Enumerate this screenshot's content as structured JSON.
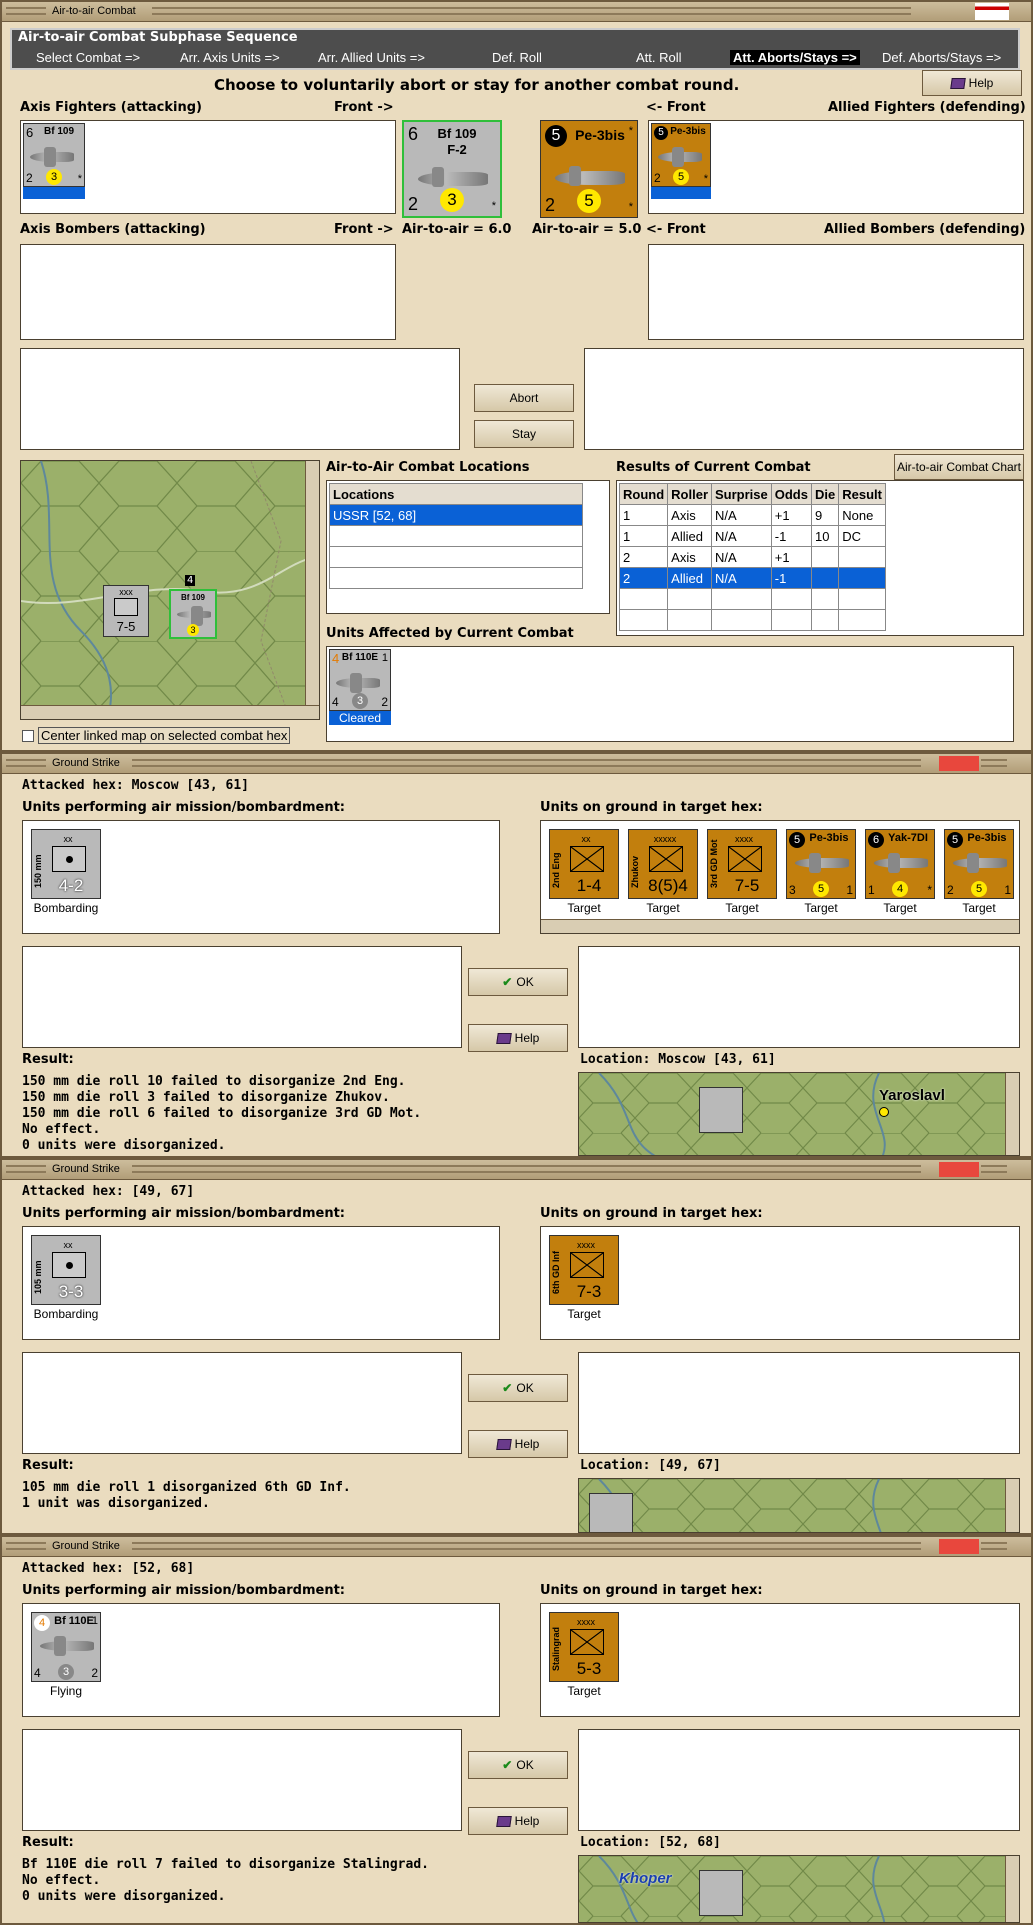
{
  "air": {
    "window_title": "Air-to-air Combat",
    "sequence_title": "Air-to-air Combat Subphase Sequence",
    "steps": [
      "Select Combat =>",
      "Arr. Axis Units =>",
      "Arr. Allied Units =>",
      "Def. Roll",
      "Att. Roll",
      "Att. Aborts/Stays =>",
      "Def. Aborts/Stays =>"
    ],
    "instruction": "Choose to voluntarily abort or stay for another combat round.",
    "help": "Help",
    "axis_fighters": "Axis Fighters (attacking)",
    "front_right": "Front ->",
    "front_left": "<- Front",
    "allied_fighters": "Allied Fighters (defending)",
    "axis_bombers": "Axis Bombers (attacking)",
    "allied_bombers": "Allied Bombers (defending)",
    "axis_ata": "Air-to-air = 6.0",
    "allied_ata": "Air-to-air = 5.0",
    "abort": "Abort",
    "stay": "Stay",
    "locations_title": "Air-to-Air Combat Locations",
    "locations_header": "Locations",
    "locations": [
      "USSR [52, 68]"
    ],
    "results_title": "Results of Current Combat",
    "chart_btn": "Air-to-air Combat Chart",
    "results_headers": [
      "Round",
      "Roller",
      "Surprise",
      "Odds",
      "Die",
      "Result"
    ],
    "results_rows": [
      [
        "1",
        "Axis",
        "N/A",
        "+1",
        "9",
        "None"
      ],
      [
        "1",
        "Allied",
        "N/A",
        "-1",
        "10",
        "DC"
      ],
      [
        "2",
        "Axis",
        "N/A",
        "+1",
        "",
        ""
      ],
      [
        "2",
        "Allied",
        "N/A",
        "-1",
        "",
        ""
      ]
    ],
    "affected_title": "Units Affected by Current Combat",
    "affected_status": "Cleared",
    "center_label": "Center linked map on selected combat hex",
    "axis_fighter": {
      "name": "Bf 109",
      "sub": "F-2",
      "tl": "6",
      "bl": "2",
      "mid": "3",
      "tr": "*"
    },
    "allied_fighter": {
      "name": "Pe-3bis",
      "tl": "5",
      "bl": "2",
      "mid": "5",
      "tr": "*"
    },
    "affected_unit": {
      "name": "Bf 110E",
      "tl": "4",
      "tr": "1",
      "bl": "4",
      "mid": "3",
      "br": "2"
    },
    "map_units": {
      "inf": "7-5",
      "inf_top": "xxx",
      "ftr": "Bf 109",
      "stack": "4"
    }
  },
  "strikes": [
    {
      "window_title": "Ground Strike",
      "attacked_hex": "Attacked hex: Moscow  [43, 61]",
      "performing_label": "Units performing air mission/bombardment:",
      "ground_label": "Units on ground in target hex:",
      "attacker": {
        "type": "art",
        "size": "150 mm",
        "top": "xx",
        "str": "4-2",
        "cap": "Bombarding"
      },
      "targets": [
        {
          "type": "unit",
          "side": "2nd Eng",
          "top": "xx",
          "str": "1-4",
          "cap": "Target"
        },
        {
          "type": "unit",
          "side": "Zhukov",
          "top": "xxxxx",
          "str": "8(5)4",
          "cap": "Target"
        },
        {
          "type": "unit",
          "side": "3rd GD Mot",
          "top": "xxxx",
          "str": "7-5",
          "cap": "Target"
        },
        {
          "type": "plane",
          "name": "Pe-3bis",
          "tl": "5",
          "bl": "3",
          "mid": "5",
          "br": "1",
          "cap": "Target"
        },
        {
          "type": "plane",
          "name": "Yak-7DI",
          "tl": "6",
          "bl": "1",
          "mid": "4",
          "br": "*",
          "cap": "Target"
        },
        {
          "type": "plane",
          "name": "Pe-3bis",
          "tl": "5",
          "bl": "2",
          "mid": "5",
          "br": "1",
          "cap": "Target"
        }
      ],
      "ok": "OK",
      "help": "Help",
      "result_label": "Result:",
      "result_lines": [
        "150 mm die roll 10 failed to disorganize 2nd Eng.",
        "150 mm die roll 3 failed to disorganize Zhukov.",
        "150 mm die roll 6 failed to disorganize 3rd GD Mot.",
        "No effect.",
        "0 units were disorganized."
      ],
      "location_label": "Location:  Moscow  [43, 61]",
      "map_label": "Yaroslavl"
    },
    {
      "window_title": "Ground Strike",
      "attacked_hex": "Attacked hex:  [49, 67]",
      "performing_label": "Units performing air mission/bombardment:",
      "ground_label": "Units on ground in target hex:",
      "attacker": {
        "type": "art",
        "size": "105 mm",
        "top": "xx",
        "str": "3-3",
        "cap": "Bombarding"
      },
      "targets": [
        {
          "type": "unit",
          "side": "6th GD Inf",
          "top": "xxxx",
          "str": "7-3",
          "cap": "Target"
        }
      ],
      "ok": "OK",
      "help": "Help",
      "result_label": "Result:",
      "result_lines": [
        "105 mm die roll 1 disorganized 6th GD Inf.",
        "1 unit was disorganized."
      ],
      "location_label": "Location:  [49, 67]",
      "map_label": ""
    },
    {
      "window_title": "Ground Strike",
      "attacked_hex": "Attacked hex:  [52, 68]",
      "performing_label": "Units performing air mission/bombardment:",
      "ground_label": "Units on ground in target hex:",
      "attacker": {
        "type": "plane",
        "name": "Bf 110E",
        "tl": "4",
        "tr": "1",
        "bl": "4",
        "mid": "3",
        "br": "2",
        "cap": "Flying"
      },
      "targets": [
        {
          "type": "unit",
          "side": "Stalingrad",
          "top": "xxxx",
          "str": "5-3",
          "cap": "Target"
        }
      ],
      "ok": "OK",
      "help": "Help",
      "result_label": "Result:",
      "result_lines": [
        "Bf 110E die roll 7 failed to disorganize Stalingrad.",
        "No effect.",
        "0 units were disorganized."
      ],
      "location_label": "Location:  [52, 68]",
      "map_label": "Khoper"
    }
  ],
  "colors": {
    "axis_gray": "#b9b9b9",
    "soviet_orange": "#c27f0d",
    "select_blue": "#0a61d6",
    "window_tan": "#eadcbf"
  }
}
